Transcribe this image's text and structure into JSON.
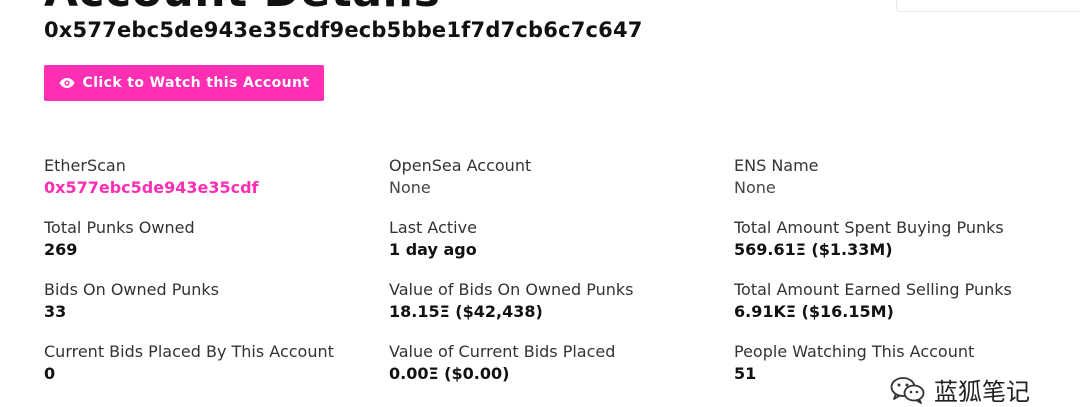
{
  "header": {
    "title": "Account Details",
    "address": "0x577ebc5de943e35cdf9ecb5bbe1f7d7cb6c7c647"
  },
  "watch_button": {
    "label": "Click to Watch this Account",
    "icon": "eye-icon"
  },
  "stats": {
    "etherscan": {
      "label": "EtherScan",
      "value": "0x577ebc5de943e35cdf"
    },
    "opensea": {
      "label": "OpenSea Account",
      "value": "None"
    },
    "ens": {
      "label": "ENS Name",
      "value": "None"
    },
    "punks_owned": {
      "label": "Total Punks Owned",
      "value": "269"
    },
    "last_active": {
      "label": "Last Active",
      "value": "1 day ago"
    },
    "spent_buying": {
      "label": "Total Amount Spent Buying Punks",
      "value": "569.61Ξ ($1.33M)"
    },
    "bids_owned": {
      "label": "Bids On Owned Punks",
      "value": "33"
    },
    "bids_value": {
      "label": "Value of Bids On Owned Punks",
      "value": "18.15Ξ ($42,438)"
    },
    "earned_selling": {
      "label": "Total Amount Earned Selling Punks",
      "value": "6.91KΞ ($16.15M)"
    },
    "current_bids": {
      "label": "Current Bids Placed By This Account",
      "value": "0"
    },
    "current_bids_value": {
      "label": "Value of Current Bids Placed",
      "value": "0.00Ξ ($0.00)"
    },
    "watchers": {
      "label": "People Watching This Account",
      "value": "51"
    }
  },
  "watermark": {
    "text": "蓝狐笔记",
    "icon": "wechat-icon"
  },
  "colors": {
    "accent": "#ff2fb3",
    "text": "#111111"
  }
}
